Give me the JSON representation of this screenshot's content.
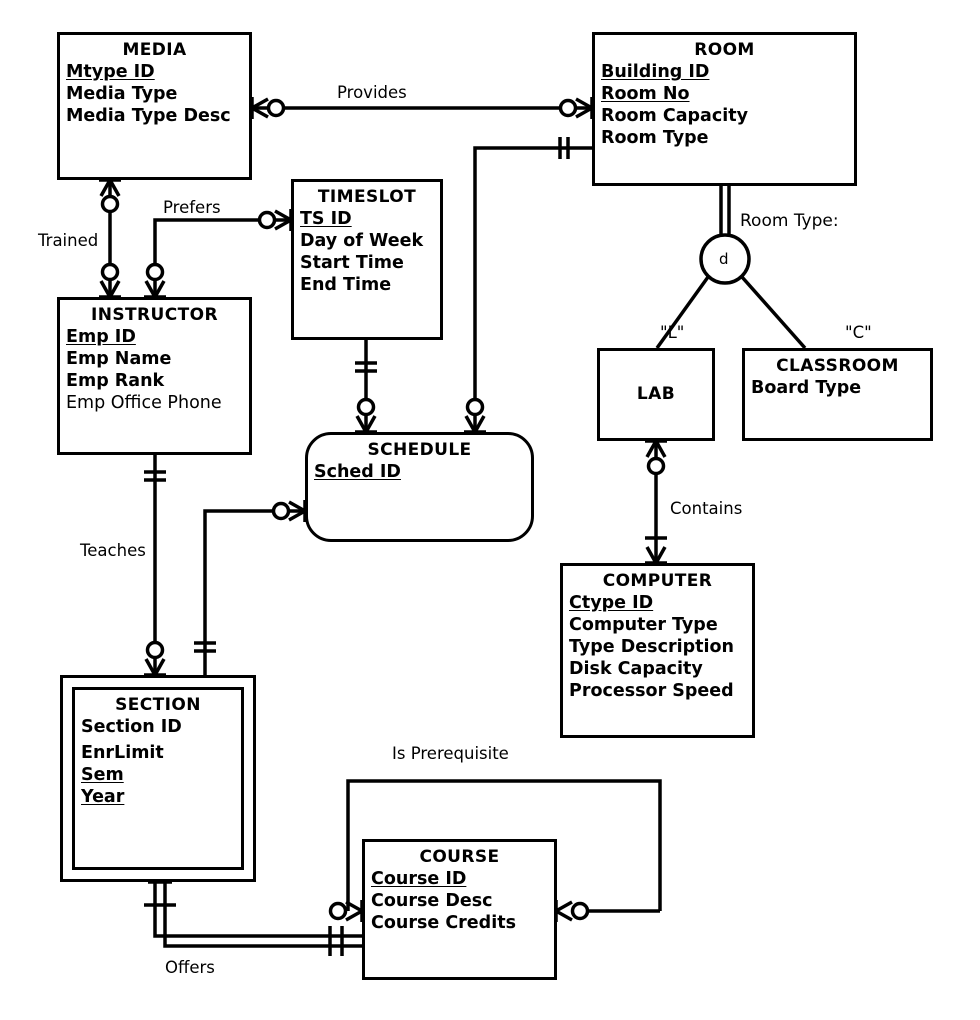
{
  "diagram": {
    "type": "entity-relationship-diagram",
    "notation": "crow's foot",
    "colors": {
      "line": "#000000",
      "fill": "#ffffff",
      "text": "#000000"
    }
  },
  "entities": [
    {
      "id": "media",
      "name": "MEDIA",
      "kind": "strong",
      "attributes": [
        {
          "label": "Mtype ID",
          "key": "primary"
        },
        {
          "label": "Media Type",
          "key": "none"
        },
        {
          "label": "Media Type  Desc",
          "key": "none"
        }
      ]
    },
    {
      "id": "room",
      "name": "ROOM",
      "kind": "strong",
      "attributes": [
        {
          "label": "Building ID",
          "key": "primary"
        },
        {
          "label": "Room No",
          "key": "primary"
        },
        {
          "label": "Room Capacity",
          "key": "none"
        },
        {
          "label": "Room Type",
          "key": "none"
        }
      ]
    },
    {
      "id": "timeslot",
      "name": "TIMESLOT",
      "kind": "strong",
      "attributes": [
        {
          "label": "TS ID",
          "key": "primary"
        },
        {
          "label": "Day of Week",
          "key": "none"
        },
        {
          "label": "Start Time",
          "key": "none"
        },
        {
          "label": "End Time",
          "key": "none"
        }
      ]
    },
    {
      "id": "instructor",
      "name": "INSTRUCTOR",
      "kind": "strong",
      "attributes": [
        {
          "label": "Emp ID",
          "key": "primary"
        },
        {
          "label": "Emp Name",
          "key": "none"
        },
        {
          "label": "Emp Rank",
          "key": "none"
        },
        {
          "label": "Emp Office Phone",
          "key": "none",
          "weight": "regular"
        }
      ]
    },
    {
      "id": "schedule",
      "name": "SCHEDULE",
      "kind": "associative",
      "attributes": [
        {
          "label": "Sched ID",
          "key": "primary"
        }
      ]
    },
    {
      "id": "lab",
      "name": "LAB",
      "kind": "subtype",
      "attributes": []
    },
    {
      "id": "classroom",
      "name": "CLASSROOM",
      "kind": "subtype",
      "attributes": [
        {
          "label": "Board Type",
          "key": "none"
        }
      ]
    },
    {
      "id": "computer",
      "name": "COMPUTER",
      "kind": "strong",
      "attributes": [
        {
          "label": "Ctype ID",
          "key": "primary"
        },
        {
          "label": "Computer Type",
          "key": "none"
        },
        {
          "label": "Type Description",
          "key": "none"
        },
        {
          "label": "Disk Capacity",
          "key": "none"
        },
        {
          "label": "Processor Speed",
          "key": "none"
        }
      ]
    },
    {
      "id": "section",
      "name": "SECTION",
      "kind": "weak",
      "attributes": [
        {
          "label": "Section ID",
          "key": "partial"
        },
        {
          "label": "EnrLimit",
          "key": "none"
        },
        {
          "label": "Sem",
          "key": "primary"
        },
        {
          "label": "Year",
          "key": "primary"
        }
      ]
    },
    {
      "id": "course",
      "name": "COURSE",
      "kind": "strong",
      "attributes": [
        {
          "label": "Course ID",
          "key": "primary"
        },
        {
          "label": "Course Desc",
          "key": "none"
        },
        {
          "label": "Course Credits",
          "key": "none"
        }
      ]
    }
  ],
  "relationships": [
    {
      "id": "provides",
      "label": "Provides",
      "from": "media",
      "to": "room"
    },
    {
      "id": "trained",
      "label": "Trained",
      "from": "media",
      "to": "instructor"
    },
    {
      "id": "prefers",
      "label": "Prefers",
      "from": "timeslot",
      "to": "instructor"
    },
    {
      "id": "teaches",
      "label": "Teaches",
      "from": "instructor",
      "to": "section"
    },
    {
      "id": "contains",
      "label": "Contains",
      "from": "lab",
      "to": "computer"
    },
    {
      "id": "offers",
      "label": "Offers",
      "from": "section",
      "to": "course",
      "identifying": true
    },
    {
      "id": "is-prerequisite",
      "label": "Is Prerequisite",
      "from": "course",
      "to": "course",
      "recursive": true
    }
  ],
  "specialization": {
    "id": "room-type-spec",
    "discriminator_label": "Room Type:",
    "symbol": "d",
    "symbol_meaning": "disjoint",
    "supertype": "room",
    "subtypes": [
      {
        "entity": "lab",
        "discriminator_value": "\"L\""
      },
      {
        "entity": "classroom",
        "discriminator_value": "\"C\""
      }
    ]
  }
}
